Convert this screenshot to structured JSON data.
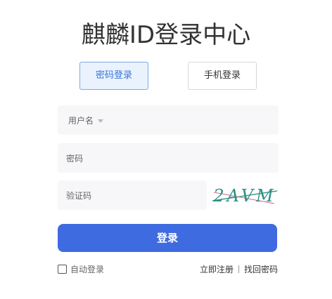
{
  "page": {
    "title": "麒麟ID登录中心"
  },
  "tabs": [
    {
      "label": "密码登录",
      "active": true
    },
    {
      "label": "手机登录",
      "active": false
    }
  ],
  "form": {
    "username_placeholder": "用户名",
    "password_placeholder": "密码",
    "captcha_placeholder": "验证码",
    "captcha_text": "2AVM",
    "login_label": "登录"
  },
  "footer": {
    "remember_label": "自动登录",
    "register_label": "立即注册",
    "forgot_label": "找回密码"
  },
  "colors": {
    "primary": "#3f6be0",
    "tab_active_bg": "#e9f2fd",
    "tab_active_border": "#7fa7e6",
    "field_bg": "#f7f7f9"
  }
}
